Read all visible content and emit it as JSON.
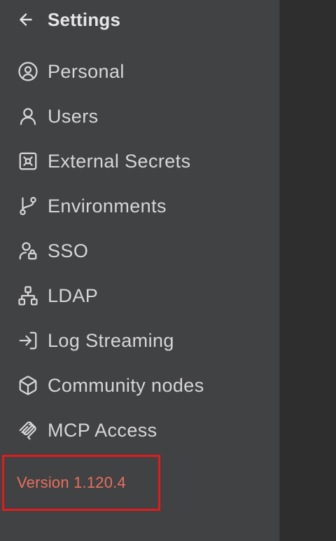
{
  "header": {
    "title": "Settings",
    "back_icon": "arrow-left-icon"
  },
  "menu": {
    "items": [
      {
        "label": "Personal",
        "icon": "user-circle-icon"
      },
      {
        "label": "Users",
        "icon": "user-icon"
      },
      {
        "label": "External Secrets",
        "icon": "vault-icon"
      },
      {
        "label": "Environments",
        "icon": "git-branch-icon"
      },
      {
        "label": "SSO",
        "icon": "user-lock-icon"
      },
      {
        "label": "LDAP",
        "icon": "network-icon"
      },
      {
        "label": "Log Streaming",
        "icon": "log-in-icon"
      },
      {
        "label": "Community nodes",
        "icon": "box-icon"
      },
      {
        "label": "MCP Access",
        "icon": "mcp-icon"
      }
    ]
  },
  "footer": {
    "version": "Version 1.120.4"
  },
  "colors": {
    "sidebar_bg": "#414244",
    "main_bg": "#2e2e2f",
    "text": "#d6d6d9",
    "version_text": "#ea6f5c",
    "highlight_border": "#e31b1b"
  }
}
